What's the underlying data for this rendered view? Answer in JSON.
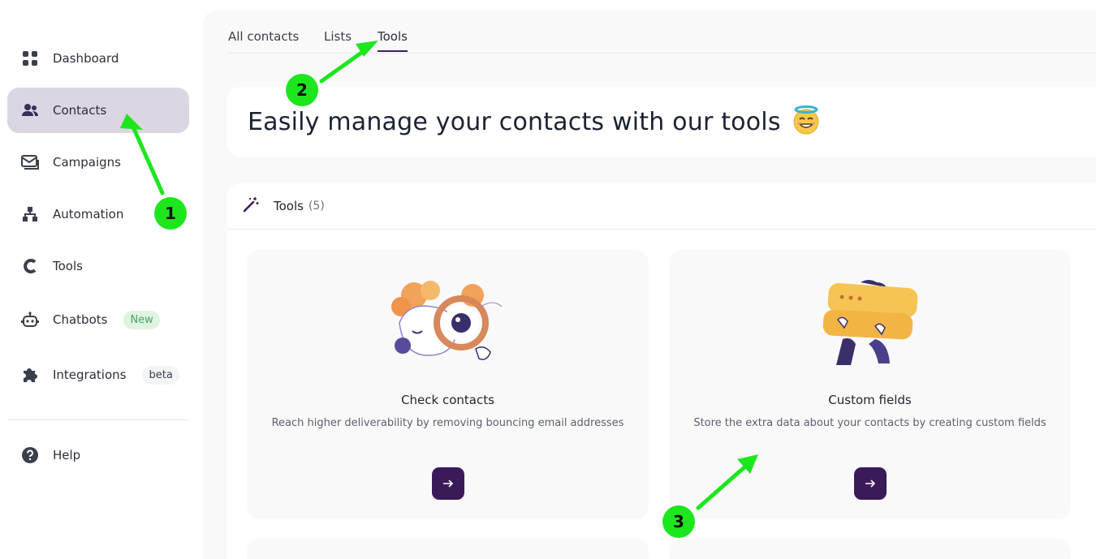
{
  "sidebar": {
    "items": [
      {
        "label": "Dashboard",
        "icon": "dashboard-icon"
      },
      {
        "label": "Contacts",
        "icon": "contacts-icon"
      },
      {
        "label": "Campaigns",
        "icon": "campaigns-icon"
      },
      {
        "label": "Automation",
        "icon": "automation-icon"
      },
      {
        "label": "Tools",
        "icon": "tools-icon"
      },
      {
        "label": "Chatbots",
        "icon": "chatbot-icon",
        "badge": "New"
      },
      {
        "label": "Integrations",
        "icon": "puzzle-icon",
        "badge": "beta"
      },
      {
        "label": "Help",
        "icon": "help-icon"
      }
    ],
    "active": "Contacts"
  },
  "tabs": [
    {
      "label": "All contacts"
    },
    {
      "label": "Lists"
    },
    {
      "label": "Tools"
    }
  ],
  "active_tab": "Tools",
  "hero": {
    "title": "Easily manage your contacts with our tools"
  },
  "tools": {
    "label": "Tools",
    "count": "(5)",
    "cards": [
      {
        "title": "Check contacts",
        "description": "Reach higher deliverability by removing bouncing email addresses",
        "button_icon": "arrow-right-icon"
      },
      {
        "title": "Custom fields",
        "description": "Store the extra data about your contacts by creating custom fields",
        "button_icon": "arrow-right-icon"
      }
    ]
  },
  "annotations": {
    "steps": [
      "1",
      "2",
      "3"
    ],
    "color": "#1ee61e"
  },
  "colors": {
    "accent": "#3b1a5a",
    "active_nav_bg": "#dcd6e3",
    "badge_new_bg": "#dff3e1",
    "badge_new_text": "#4aa85a"
  }
}
